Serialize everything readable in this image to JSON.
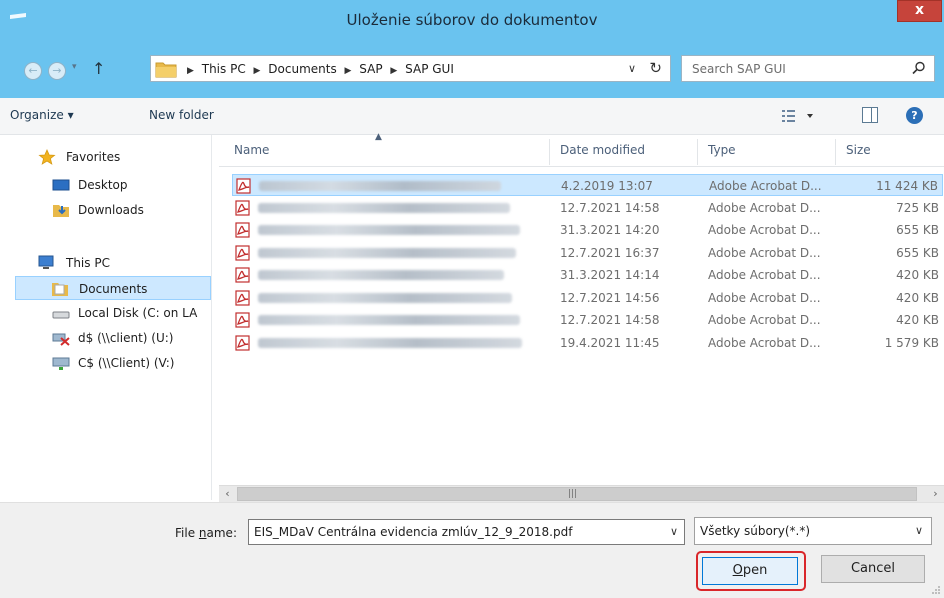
{
  "window": {
    "title": "Uloženie súborov do dokumentov",
    "close_label": "x"
  },
  "address": {
    "crumbs": [
      "This PC",
      "Documents",
      "SAP",
      "SAP GUI"
    ],
    "search_placeholder": "Search SAP GUI"
  },
  "toolbar": {
    "organize_label": "Organize ▾",
    "new_folder_label": "New folder"
  },
  "nav": {
    "favorites": "Favorites",
    "desktop": "Desktop",
    "downloads": "Downloads",
    "this_pc": "This PC",
    "documents": "Documents",
    "local_disk": "Local Disk (C: on LA",
    "d_drive": "d$ (\\\\client) (U:)",
    "c_drive": "C$ (\\\\Client) (V:)"
  },
  "columns": {
    "name": "Name",
    "date": "Date modified",
    "type": "Type",
    "size": "Size"
  },
  "files": [
    {
      "date": "4.2.2019 13:07",
      "type": "Adobe Acrobat D...",
      "size": "11 424 KB",
      "selected": true
    },
    {
      "date": "12.7.2021 14:58",
      "type": "Adobe Acrobat D...",
      "size": "725 KB",
      "selected": false
    },
    {
      "date": "31.3.2021 14:20",
      "type": "Adobe Acrobat D...",
      "size": "655 KB",
      "selected": false
    },
    {
      "date": "12.7.2021 16:37",
      "type": "Adobe Acrobat D...",
      "size": "655 KB",
      "selected": false
    },
    {
      "date": "31.3.2021 14:14",
      "type": "Adobe Acrobat D...",
      "size": "420 KB",
      "selected": false
    },
    {
      "date": "12.7.2021 14:56",
      "type": "Adobe Acrobat D...",
      "size": "420 KB",
      "selected": false
    },
    {
      "date": "12.7.2021 14:58",
      "type": "Adobe Acrobat D...",
      "size": "420 KB",
      "selected": false
    },
    {
      "date": "19.4.2021 11:45",
      "type": "Adobe Acrobat D...",
      "size": "1 579 KB",
      "selected": false
    }
  ],
  "bottom": {
    "file_name_prefix": "File ",
    "file_name_underlined": "n",
    "file_name_suffix": "ame:",
    "file_name_value": "EIS_MDaV Centrálna evidencia zmlúv_12_9_2018.pdf",
    "file_type_value": "Všetky súbory(*.*)",
    "open_underlined": "O",
    "open_rest": "pen",
    "cancel_label": "Cancel"
  },
  "colors": {
    "title_bar": "#6ac3ef",
    "close_button": "#c6443b",
    "selection": "#cce8ff",
    "highlight_box": "#d9262a"
  }
}
